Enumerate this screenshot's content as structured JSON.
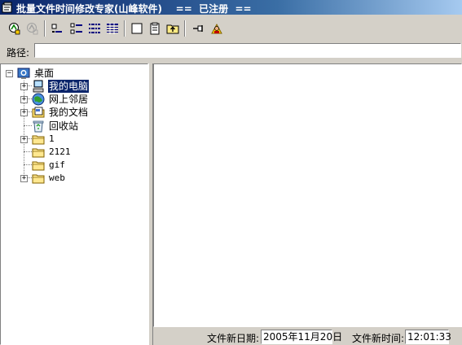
{
  "window": {
    "title": "批量文件时间修改专家(山峰软件)    ==  已注册  =="
  },
  "toolbar": {
    "buttons": [
      {
        "icon": "run-icon",
        "enabled": true
      },
      {
        "icon": "stop-icon",
        "enabled": false
      },
      {
        "icon": "large-icons-view-icon"
      },
      {
        "icon": "small-icons-view-icon"
      },
      {
        "icon": "list-view-icon"
      },
      {
        "icon": "details-view-icon"
      },
      {
        "icon": "new-folder-icon"
      },
      {
        "icon": "properties-icon"
      },
      {
        "icon": "up-folder-icon"
      },
      {
        "icon": "pin-icon"
      },
      {
        "icon": "help-icon"
      }
    ]
  },
  "path": {
    "label": "路径:",
    "value": ""
  },
  "tree": {
    "root": "桌面",
    "items": [
      {
        "label": "我的电脑",
        "icon": "computer-icon",
        "expandable": true,
        "selected": true
      },
      {
        "label": "网上邻居",
        "icon": "network-icon",
        "expandable": true
      },
      {
        "label": "我的文档",
        "icon": "documents-icon",
        "expandable": true
      },
      {
        "label": "回收站",
        "icon": "recycle-bin-icon",
        "expandable": false
      },
      {
        "label": "1",
        "icon": "folder-icon",
        "expandable": true
      },
      {
        "label": "2121",
        "icon": "folder-icon",
        "expandable": false
      },
      {
        "label": "gif",
        "icon": "folder-icon",
        "expandable": false
      },
      {
        "label": "web",
        "icon": "folder-icon",
        "expandable": true
      }
    ]
  },
  "status": {
    "new_date_label": "文件新日期:",
    "new_date_value": "2005年11月20日",
    "new_time_label": "文件新时间:",
    "new_time_value": "12:01:33"
  },
  "colors": {
    "titlebar": "#0a246a",
    "face": "#d4d0c8",
    "selection": "#0a246a"
  }
}
